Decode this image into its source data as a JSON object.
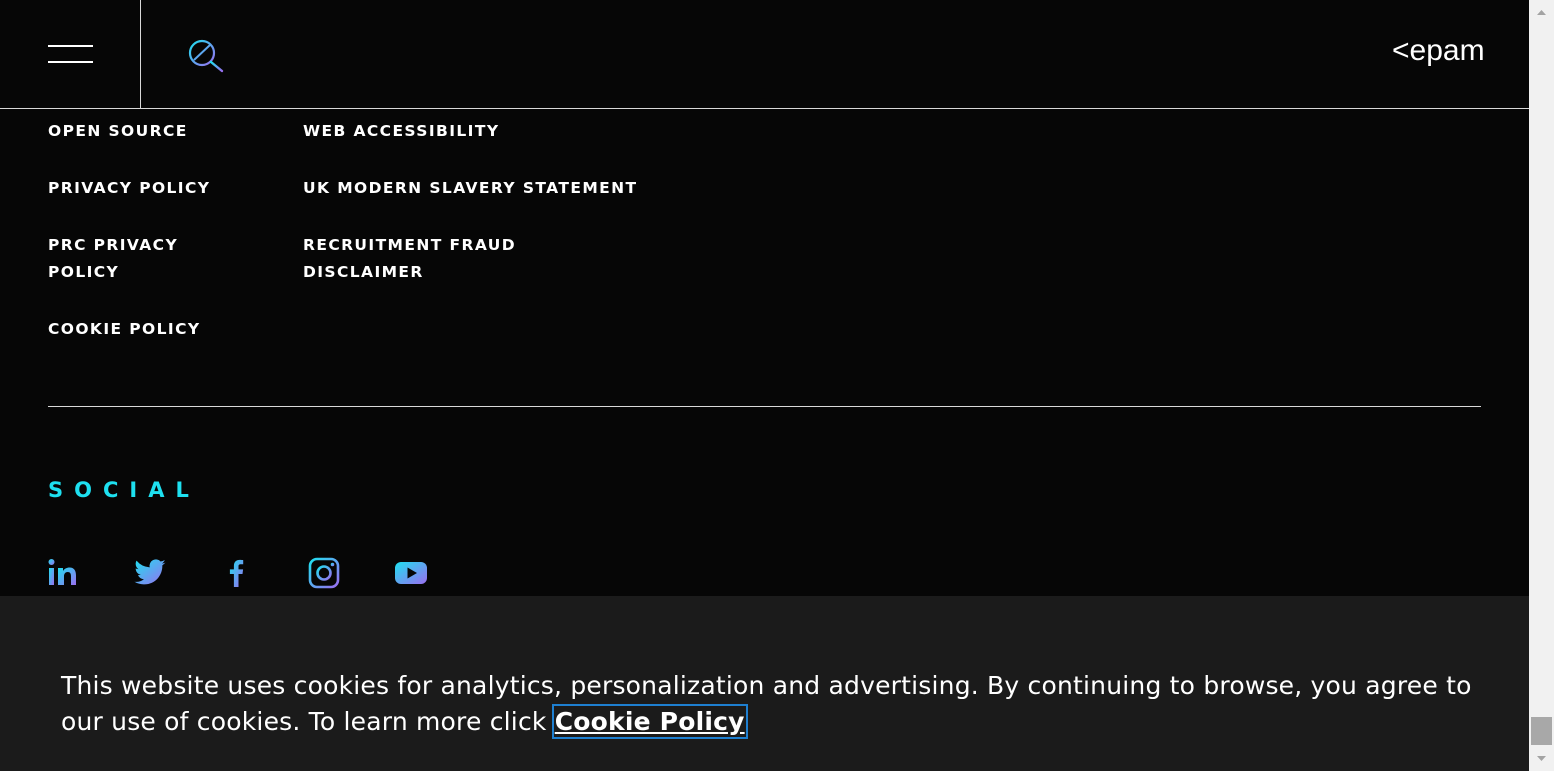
{
  "header": {
    "menu_icon": "hamburger-menu-icon",
    "search_icon": "search-icon",
    "logo_text": "<epam>"
  },
  "footer_links": {
    "col1": [
      "OPEN SOURCE",
      "PRIVACY POLICY",
      "PRC PRIVACY",
      "POLICY",
      "COOKIE POLICY"
    ],
    "col2": [
      "WEB ACCESSIBILITY",
      "UK MODERN SLAVERY STATEMENT",
      "RECRUITMENT FRAUD",
      "DISCLAIMER"
    ]
  },
  "social": {
    "title": "SOCIAL",
    "icons": [
      "linkedin-icon",
      "twitter-icon",
      "facebook-icon",
      "instagram-icon",
      "youtube-icon"
    ]
  },
  "cookie_banner": {
    "text": "This website uses cookies for analytics, personalization and advertising. By continuing to browse, you agree to our use of cookies. To learn more click ",
    "link_text": "Cookie Policy"
  },
  "colors": {
    "background": "#060606",
    "accent_cyan": "#1ee0f0",
    "accent_purple": "#9a6ef0",
    "banner_bg": "#1b1b1b",
    "focus_outline": "#1e7fd0"
  }
}
